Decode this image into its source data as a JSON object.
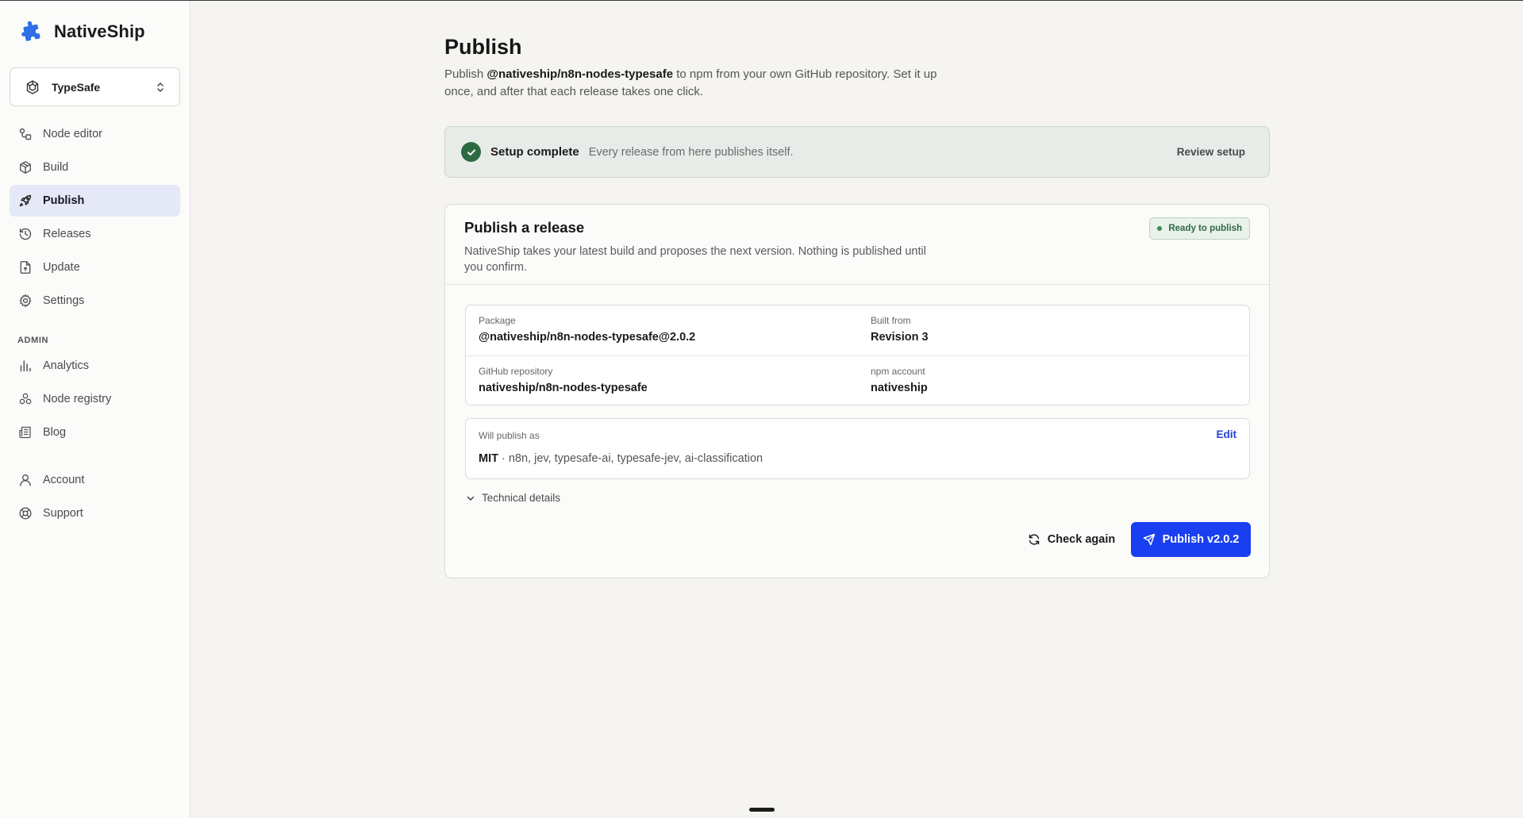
{
  "colors": {
    "accent": "#1a3ff0",
    "brand": "#2f6fe6",
    "success": "#2c6b42",
    "active_nav_bg": "#e5e8f6"
  },
  "brand": {
    "name": "NativeShip",
    "logo_icon": "puzzle-piece-icon"
  },
  "workspace": {
    "name": "TypeSafe",
    "icon": "cube-hex-icon",
    "chevron_icon": "chevron-updown-icon"
  },
  "sidebar": {
    "items": [
      {
        "label": "Node editor",
        "icon": "node-editor-icon",
        "active": false
      },
      {
        "label": "Build",
        "icon": "box-icon",
        "active": false
      },
      {
        "label": "Publish",
        "icon": "rocket-icon",
        "active": true
      },
      {
        "label": "Releases",
        "icon": "history-icon",
        "active": false
      },
      {
        "label": "Update",
        "icon": "file-upload-icon",
        "active": false
      },
      {
        "label": "Settings",
        "icon": "gear-icon",
        "active": false
      }
    ],
    "admin_heading": "ADMIN",
    "admin_items": [
      {
        "label": "Analytics",
        "icon": "bar-chart-icon"
      },
      {
        "label": "Node registry",
        "icon": "registry-icon"
      },
      {
        "label": "Blog",
        "icon": "newspaper-icon"
      }
    ],
    "bottom_items": [
      {
        "label": "Account",
        "icon": "user-icon"
      },
      {
        "label": "Support",
        "icon": "lifebuoy-icon"
      }
    ]
  },
  "page": {
    "title": "Publish",
    "desc_prefix": "Publish ",
    "desc_package": "@nativeship/n8n-nodes-typesafe",
    "desc_suffix": " to npm from your own GitHub repository. Set it up once, and after that each release takes one click."
  },
  "setup": {
    "title": "Setup complete",
    "description": "Every release from here publishes itself.",
    "review_label": "Review setup"
  },
  "release": {
    "title": "Publish a release",
    "subtitle": "NativeShip takes your latest build and proposes the next version. Nothing is published until you confirm.",
    "badge": "Ready to publish",
    "info": {
      "package_label": "Package",
      "package_value": "@nativeship/n8n-nodes-typesafe@2.0.2",
      "built_from_label": "Built from",
      "built_from_value": "Revision 3",
      "repo_label": "GitHub repository",
      "repo_value": "nativeship/n8n-nodes-typesafe",
      "npm_label": "npm account",
      "npm_value": "nativeship"
    },
    "publish_as": {
      "label": "Will publish as",
      "edit_label": "Edit",
      "license": "MIT",
      "keywords": " · n8n, jev, typesafe-ai, typesafe-jev, ai-classification"
    },
    "technical_details_label": "Technical details",
    "check_again_label": "Check again",
    "publish_label": "Publish v2.0.2"
  }
}
